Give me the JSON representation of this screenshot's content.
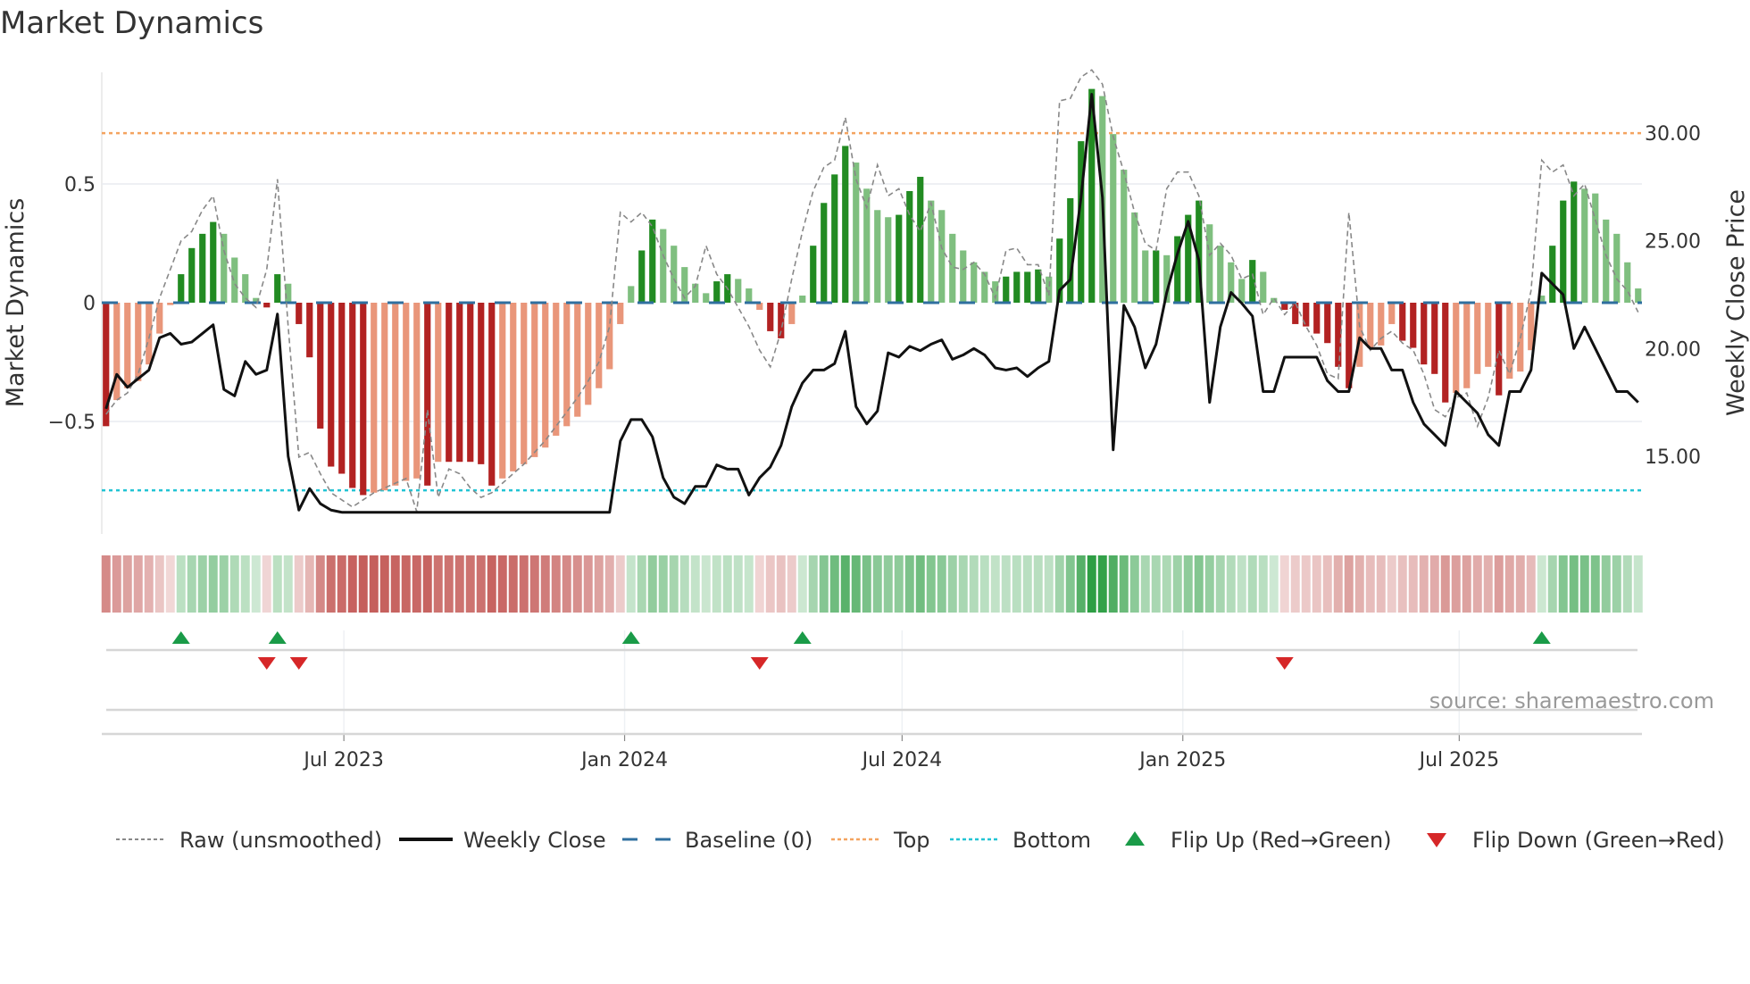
{
  "title": "Market Dynamics",
  "source": "source: sharemaestro.com",
  "chart_data": {
    "type": "bar",
    "title": "Market Dynamics",
    "ylabel": "Market Dynamics",
    "y2label": "Weekly Close Price",
    "ylim": [
      -0.97,
      0.98
    ],
    "y2lim": [
      12.0,
      33.0
    ],
    "yticks": [
      {
        "v": 0.5,
        "label": "0.5"
      },
      {
        "v": 0,
        "label": "0"
      },
      {
        "v": -0.5,
        "label": "−0.5"
      }
    ],
    "y2ticks": [
      {
        "v": 30,
        "label": "30.00"
      },
      {
        "v": 25,
        "label": "25.00"
      },
      {
        "v": 20,
        "label": "20.00"
      },
      {
        "v": 15,
        "label": "15.00"
      }
    ],
    "xticks": [
      {
        "week": 22.2,
        "label": "Jul 2023"
      },
      {
        "week": 48.4,
        "label": "Jan 2024"
      },
      {
        "week": 74.3,
        "label": "Jul 2024"
      },
      {
        "week": 100.5,
        "label": "Jan 2025"
      },
      {
        "week": 126.3,
        "label": "Jul 2025"
      }
    ],
    "top": 0.714,
    "bottom": -0.79,
    "baseline": 0,
    "values": [
      -0.52,
      -0.41,
      -0.36,
      -0.33,
      -0.26,
      -0.13,
      -0.01,
      0.12,
      0.23,
      0.29,
      0.34,
      0.29,
      0.19,
      0.12,
      0.02,
      -0.02,
      0.12,
      0.08,
      -0.09,
      -0.23,
      -0.53,
      -0.69,
      -0.72,
      -0.78,
      -0.81,
      -0.8,
      -0.79,
      -0.77,
      -0.75,
      -0.74,
      -0.77,
      -0.67,
      -0.67,
      -0.67,
      -0.67,
      -0.68,
      -0.77,
      -0.74,
      -0.71,
      -0.68,
      -0.65,
      -0.61,
      -0.56,
      -0.52,
      -0.48,
      -0.43,
      -0.36,
      -0.28,
      -0.09,
      0.07,
      0.22,
      0.35,
      0.31,
      0.24,
      0.15,
      0.08,
      0.04,
      0.09,
      0.12,
      0.1,
      0.06,
      -0.03,
      -0.12,
      -0.15,
      -0.09,
      0.03,
      0.24,
      0.42,
      0.54,
      0.66,
      0.59,
      0.48,
      0.39,
      0.36,
      0.37,
      0.47,
      0.53,
      0.43,
      0.39,
      0.29,
      0.22,
      0.17,
      0.13,
      0.09,
      0.11,
      0.13,
      0.13,
      0.14,
      0.11,
      0.27,
      0.44,
      0.68,
      0.9,
      0.87,
      0.71,
      0.56,
      0.38,
      0.22,
      0.22,
      0.2,
      0.28,
      0.37,
      0.43,
      0.33,
      0.24,
      0.17,
      0.1,
      0.18,
      0.13,
      0.02,
      -0.03,
      -0.09,
      -0.1,
      -0.13,
      -0.17,
      -0.27,
      -0.36,
      -0.27,
      -0.19,
      -0.18,
      -0.09,
      -0.16,
      -0.19,
      -0.26,
      -0.3,
      -0.42,
      -0.38,
      -0.36,
      -0.3,
      -0.27,
      -0.39,
      -0.32,
      -0.29,
      -0.2,
      0.03,
      0.24,
      0.43,
      0.51,
      0.48,
      0.46,
      0.35,
      0.29,
      0.17,
      0.06
    ],
    "raw": [
      -0.47,
      -0.41,
      -0.38,
      -0.3,
      -0.15,
      0.02,
      0.14,
      0.26,
      0.3,
      0.39,
      0.45,
      0.22,
      0.08,
      0.02,
      -0.02,
      0.14,
      0.52,
      -0.1,
      -0.65,
      -0.63,
      -0.72,
      -0.8,
      -0.83,
      -0.86,
      -0.83,
      -0.8,
      -0.78,
      -0.76,
      -0.74,
      -0.88,
      -0.45,
      -0.82,
      -0.7,
      -0.72,
      -0.78,
      -0.82,
      -0.8,
      -0.76,
      -0.72,
      -0.68,
      -0.63,
      -0.58,
      -0.52,
      -0.46,
      -0.4,
      -0.33,
      -0.25,
      -0.1,
      0.38,
      0.34,
      0.38,
      0.32,
      0.2,
      0.1,
      0.02,
      0.07,
      0.24,
      0.12,
      0.06,
      -0.02,
      -0.1,
      -0.2,
      -0.27,
      -0.12,
      0.1,
      0.3,
      0.47,
      0.57,
      0.6,
      0.78,
      0.52,
      0.4,
      0.58,
      0.45,
      0.48,
      0.37,
      0.3,
      0.42,
      0.23,
      0.15,
      0.14,
      0.17,
      0.12,
      0.02,
      0.22,
      0.23,
      0.16,
      0.16,
      0.03,
      0.85,
      0.86,
      0.95,
      0.98,
      0.92,
      0.7,
      0.55,
      0.38,
      0.25,
      0.22,
      0.48,
      0.55,
      0.55,
      0.45,
      0.2,
      0.25,
      0.2,
      0.1,
      0.12,
      -0.05,
      0.02,
      -0.05,
      0.0,
      -0.1,
      -0.18,
      -0.3,
      -0.32,
      0.38,
      -0.1,
      -0.2,
      -0.15,
      -0.12,
      -0.17,
      -0.2,
      -0.3,
      -0.45,
      -0.48,
      -0.4,
      -0.38,
      -0.52,
      -0.4,
      -0.2,
      -0.3,
      -0.15,
      0.05,
      0.6,
      0.55,
      0.58,
      0.45,
      0.5,
      0.35,
      0.2,
      0.1,
      0.05,
      -0.04
    ],
    "close": [
      17.2,
      18.8,
      18.2,
      18.6,
      19.0,
      20.5,
      20.7,
      20.2,
      20.3,
      20.7,
      21.1,
      18.1,
      17.8,
      19.4,
      18.8,
      19.0,
      21.6,
      15.0,
      12.5,
      13.5,
      12.8,
      12.5,
      12.4,
      12.4,
      12.4,
      12.4,
      12.4,
      12.4,
      12.4,
      12.4,
      12.4,
      12.4,
      12.4,
      12.4,
      12.4,
      12.4,
      12.4,
      12.4,
      12.4,
      12.4,
      12.4,
      12.4,
      12.4,
      12.4,
      12.4,
      12.4,
      12.4,
      12.4,
      15.7,
      16.7,
      16.7,
      15.9,
      14.0,
      13.1,
      12.8,
      13.6,
      13.6,
      14.6,
      14.4,
      14.4,
      13.2,
      14.0,
      14.5,
      15.5,
      17.3,
      18.4,
      19.0,
      19.0,
      19.3,
      20.8,
      17.3,
      16.5,
      17.1,
      19.8,
      19.6,
      20.1,
      19.9,
      20.2,
      20.4,
      19.5,
      19.7,
      20.0,
      19.7,
      19.1,
      19.0,
      19.1,
      18.7,
      19.1,
      19.4,
      22.7,
      23.2,
      27.0,
      31.8,
      27.0,
      15.3,
      22.0,
      21.0,
      19.1,
      20.2,
      22.6,
      24.4,
      25.9,
      24.1,
      17.5,
      21.0,
      22.6,
      22.1,
      21.5,
      18.0,
      18.0,
      19.6,
      19.6,
      19.6,
      19.6,
      18.5,
      18.0,
      18.0,
      20.5,
      20.0,
      20.0,
      19.0,
      19.0,
      17.5,
      16.5,
      16.0,
      15.5,
      18.0,
      17.5,
      17.0,
      16.0,
      15.5,
      18.0,
      18.0,
      19.0,
      23.5,
      23.0,
      22.5,
      20.0,
      21.0,
      20.0,
      19.0,
      18.0,
      18.0,
      17.5
    ],
    "flips_up": [
      7,
      16,
      49,
      65,
      134
    ],
    "flips_down": [
      15,
      18,
      61,
      110
    ],
    "colors": {
      "pos_strong": "#228b22",
      "pos_weak": "#7fbf7f",
      "neg_strong": "#b22222",
      "neg_weak": "#e9967a",
      "close": "#111111",
      "raw": "#888888",
      "baseline": "#2f6f9f",
      "top": "#f4a460",
      "bottom": "#22c4d4",
      "flip_up": "#1a9b48",
      "flip_down": "#d62728",
      "heat_pos": "#2e9e44",
      "heat_neg": "#c0504d"
    },
    "legend": [
      {
        "key": "raw",
        "label": "Raw (unsmoothed)"
      },
      {
        "key": "close",
        "label": "Weekly Close"
      },
      {
        "key": "baseline",
        "label": "Baseline (0)"
      },
      {
        "key": "top",
        "label": "Top"
      },
      {
        "key": "bottom",
        "label": "Bottom"
      },
      {
        "key": "flip_up",
        "label": "Flip Up (Red→Green)"
      },
      {
        "key": "flip_down",
        "label": "Flip Down (Green→Red)"
      }
    ],
    "legend_position": "bottom"
  }
}
